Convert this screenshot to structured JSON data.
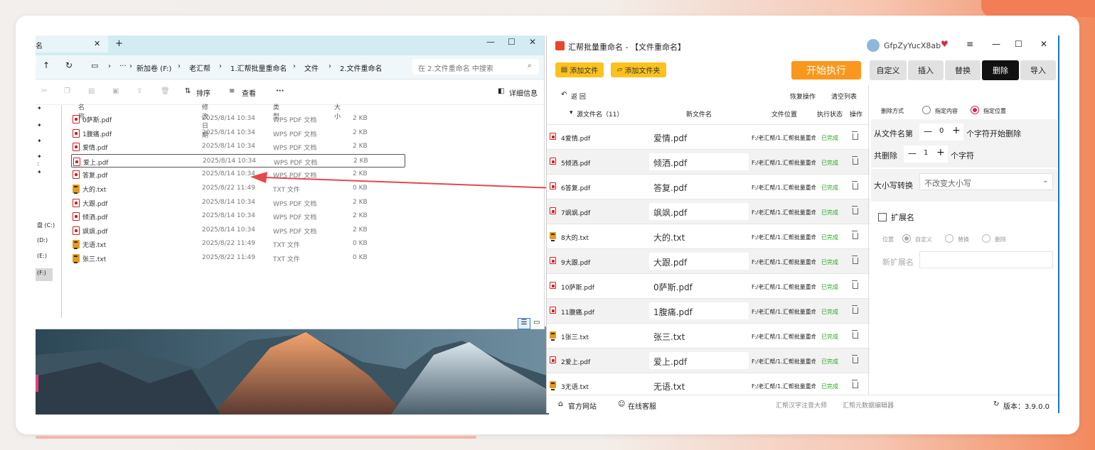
{
  "explorer": {
    "tab_title": "名",
    "toolbar": {
      "sort": "排序",
      "view": "查看",
      "more": "···",
      "details": "详细信息"
    },
    "address": {
      "more": "···",
      "crumbs": [
        "新加卷 (F:)",
        "老汇帮",
        "1.汇帮批量重命名",
        "文件",
        "2.文件重命名"
      ],
      "search_placeholder": "在 2.文件重命名 中搜索"
    },
    "sidebar": [
      ":",
      "盘 (C:)",
      "(D:)",
      "(E:)",
      "(F:)"
    ],
    "columns": {
      "name": "名称",
      "date": "修改日期",
      "type": "类型",
      "size": "大小"
    },
    "files": [
      {
        "name": "0萨斯.pdf",
        "date": "2025/8/14 10:34",
        "type": "WPS PDF 文档",
        "size": "2 KB",
        "icon": "pdf"
      },
      {
        "name": "1腹痛.pdf",
        "date": "2025/8/14 10:34",
        "type": "WPS PDF 文档",
        "size": "2 KB",
        "icon": "pdf"
      },
      {
        "name": "爱情.pdf",
        "date": "2025/8/14 10:34",
        "type": "WPS PDF 文档",
        "size": "2 KB",
        "icon": "pdf"
      },
      {
        "name": "爱上.pdf",
        "date": "2025/8/14 10:34",
        "type": "WPS PDF 文档",
        "size": "2 KB",
        "icon": "pdf"
      },
      {
        "name": "答复.pdf",
        "date": "2025/8/14 10:34",
        "type": "WPS PDF 文档",
        "size": "2 KB",
        "icon": "pdf"
      },
      {
        "name": "大的.txt",
        "date": "2025/8/22 11:49",
        "type": "TXT 文件",
        "size": "0 KB",
        "icon": "txt"
      },
      {
        "name": "大跟.pdf",
        "date": "2025/8/14 10:34",
        "type": "WPS PDF 文档",
        "size": "2 KB",
        "icon": "pdf"
      },
      {
        "name": "倾洒.pdf",
        "date": "2025/8/14 10:34",
        "type": "WPS PDF 文档",
        "size": "2 KB",
        "icon": "pdf"
      },
      {
        "name": "飒飒.pdf",
        "date": "2025/8/14 10:34",
        "type": "WPS PDF 文档",
        "size": "2 KB",
        "icon": "pdf"
      },
      {
        "name": "无语.txt",
        "date": "2025/8/22 11:49",
        "type": "TXT 文件",
        "size": "0 KB",
        "icon": "txt"
      },
      {
        "name": "张三.txt",
        "date": "2025/8/22 11:49",
        "type": "TXT 文件",
        "size": "0 KB",
        "icon": "txt"
      }
    ]
  },
  "app": {
    "title": "汇帮批量重命名 - 【文件重命名】",
    "user": "GfpZyYucX8ab",
    "add_file": "添加文件",
    "add_folder": "添加文件夹",
    "start": "开始执行",
    "back": "返  回",
    "restore": "恢复操作",
    "clear": "清空列表",
    "tabs": [
      "自定义",
      "插入",
      "替换",
      "删除",
      "导入"
    ],
    "columns": {
      "src": "源文件名（11）",
      "new": "新文件名",
      "loc": "文件位置",
      "status": "执行状态",
      "op": "操作"
    },
    "rows": [
      {
        "src": "4爱情.pdf",
        "new": "爱情.pdf",
        "loc": "F:/老汇帮/1.汇帮批量重命",
        "status": "已完成",
        "icon": "pdf"
      },
      {
        "src": "5倾洒.pdf",
        "new": "倾洒.pdf",
        "loc": "F:/老汇帮/1.汇帮批量重命",
        "status": "已完成",
        "icon": "pdf"
      },
      {
        "src": "6答复.pdf",
        "new": "答复.pdf",
        "loc": "F:/老汇帮/1.汇帮批量重命",
        "status": "已完成",
        "icon": "pdf"
      },
      {
        "src": "7飒飒.pdf",
        "new": "飒飒.pdf",
        "loc": "F:/老汇帮/1.汇帮批量重命",
        "status": "已完成",
        "icon": "pdf"
      },
      {
        "src": "8大的.txt",
        "new": "大的.txt",
        "loc": "F:/老汇帮/1.汇帮批量重命",
        "status": "已完成",
        "icon": "txt"
      },
      {
        "src": "9大跟.pdf",
        "new": "大跟.pdf",
        "loc": "F:/老汇帮/1.汇帮批量重命",
        "status": "已完成",
        "icon": "pdf"
      },
      {
        "src": "10萨斯.pdf",
        "new": "0萨斯.pdf",
        "loc": "F:/老汇帮/1.汇帮批量重命",
        "status": "已完成",
        "icon": "pdf"
      },
      {
        "src": "11腹痛.pdf",
        "new": "1腹痛.pdf",
        "loc": "F:/老汇帮/1.汇帮批量重命",
        "status": "已完成",
        "icon": "pdf"
      },
      {
        "src": "1张三.txt",
        "new": "张三.txt",
        "loc": "F:/老汇帮/1.汇帮批量重命",
        "status": "已完成",
        "icon": "txt"
      },
      {
        "src": "2爱上.pdf",
        "new": "爱上.pdf",
        "loc": "F:/老汇帮/1.汇帮批量重命",
        "status": "已完成",
        "icon": "pdf"
      },
      {
        "src": "3无语.txt",
        "new": "无语.txt",
        "loc": "F:/老汇帮/1.汇帮批量重命",
        "status": "已完成",
        "icon": "txt"
      }
    ],
    "panel": {
      "del_mode": "删除方式",
      "opt_content": "指定内容",
      "opt_position": "指定位置",
      "from_prefix": "从文件名第",
      "from_value": "0",
      "from_suffix": "个字符开始删除",
      "count_prefix": "共删除",
      "count_value": "1",
      "count_suffix": "个字符",
      "case_label": "大小写转换",
      "case_value": "不改变大小写",
      "ext_label": "扩展名",
      "pos_label": "位置",
      "ext_custom": "自定义",
      "ext_replace": "替换",
      "ext_delete": "删除",
      "new_ext": "新扩展名"
    },
    "footer": {
      "site": "官方网站",
      "service": "在线客服",
      "link1": "汇帮汉字注音大师",
      "link2": "汇帮元数据编辑器",
      "version": "版本：3.9.0.0"
    }
  },
  "colors": {
    "accent": "#fbc21d",
    "start": "#f9981c",
    "status_ok": "#2aa52a",
    "arrow": "#e8474a"
  }
}
